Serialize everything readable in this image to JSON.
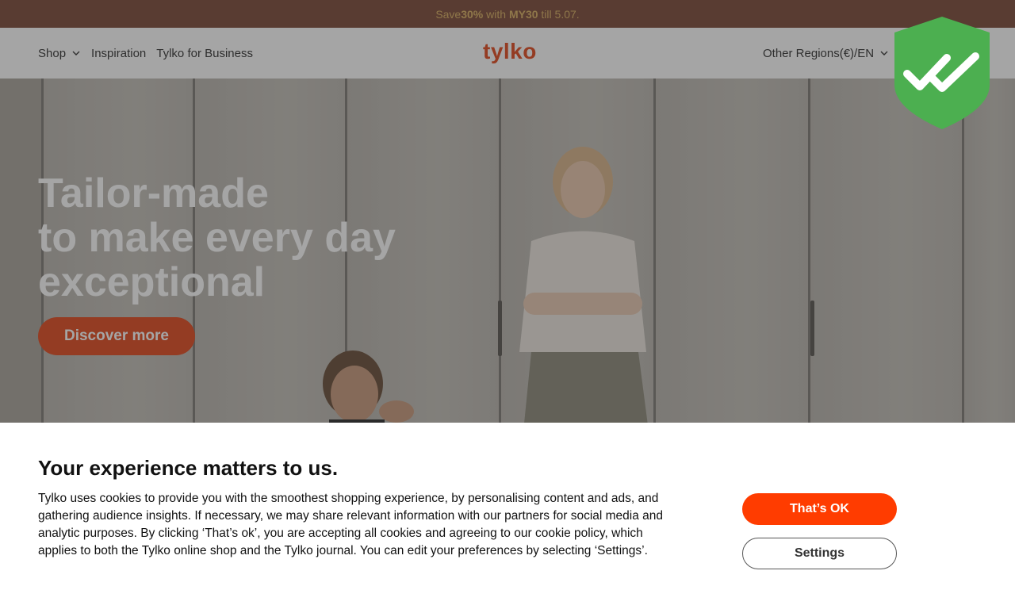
{
  "promo": {
    "prefix": "Save ",
    "discount": "30%",
    "middle": " with ",
    "code": "MY30",
    "suffix": " till 5.07."
  },
  "header": {
    "logo": "tylko",
    "nav": {
      "shop": "Shop",
      "inspiration": "Inspiration",
      "business": "Tylko for Business"
    },
    "region": "Other Regions(€)/EN"
  },
  "hero": {
    "title_line1": "Tailor-made",
    "title_line2": "to make every day",
    "title_line3": "exceptional",
    "cta": "Discover more"
  },
  "cookie": {
    "title": "Your experience matters to us.",
    "body": "Tylko uses cookies to provide you with the smoothest shopping experience, by personalising content and ads, and gathering audience insights. If necessary, we may share relevant information with our partners for social media and analytic purposes. By clicking ‘That’s ok’, you are accepting all cookies and agreeing to our cookie policy, which applies to both the Tylko online shop and the Tylko journal. You can edit your preferences by selecting ‘Settings’.",
    "ok_label": "That’s OK",
    "settings_label": "Settings"
  },
  "icons": {
    "shield": "shield-check-icon",
    "chevron": "chevron-down-icon"
  },
  "colors": {
    "accent": "#ff3c00",
    "brand": "#e24a1f",
    "promo_bg": "#7c4a3a",
    "promo_text": "#d9b062",
    "shield": "#4caf50"
  }
}
